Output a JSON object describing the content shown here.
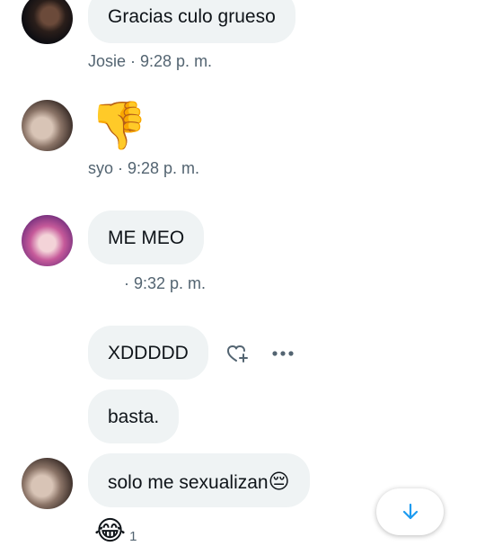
{
  "messages": [
    {
      "author": "Josie",
      "text": "Gracias culo grueso",
      "time": "9:28 p. m."
    },
    {
      "author": "syo",
      "emoji": "👎",
      "time": "9:28 p. m."
    },
    {
      "author": "",
      "text": "ME MEO",
      "time": "9:32 p. m."
    },
    {
      "text": "XDDDDD"
    },
    {
      "text": "basta."
    },
    {
      "text": "solo me sexualizan",
      "emoji": "😔",
      "reaction": {
        "emoji": "😂",
        "count": "1"
      }
    }
  ],
  "meta": {
    "josie": "Josie · 9:28 p. m.",
    "syo": "syo · 9:28 p. m.",
    "third": "· 9:32 p. m."
  },
  "icons": {
    "react": "heart-plus-icon",
    "more": "more-icon",
    "scroll": "arrow-down-icon"
  },
  "colors": {
    "bubble": "#eff3f4",
    "meta": "#536471",
    "accent": "#1d9bf0"
  }
}
